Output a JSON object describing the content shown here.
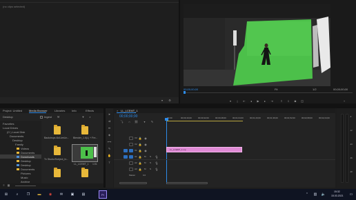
{
  "source_monitor": {
    "label": "(no clips selected)"
  },
  "program_monitor": {
    "timecode_left": "00;00;00;00",
    "fit": "Fit",
    "quality": "1/2",
    "timecode_right": "00;00;00;00"
  },
  "project_panel": {
    "tabs": [
      "Project: Untitled",
      "Media Browser",
      "Libraries",
      "Info",
      "Effects"
    ],
    "active_tab": 1,
    "path_label": "Desktop",
    "ingest_label": "Ingest",
    "tree": [
      "Favorites",
      "Local Drives",
      "(C:) Local Disk",
      "Documents",
      "Desktop",
      "Family",
      "Videos",
      "Documents",
      "Downloads",
      "Desktop",
      "Desktop",
      "Documents",
      "Pictures",
      "Music",
      "Archive",
      "Network"
    ],
    "files": [
      {
        "name": "Backdrops 4k/LiveLin...",
        "type": "folder"
      },
      {
        "name": "Blender_1.6(L) + Fre...",
        "type": "folder"
      },
      {
        "name": "Tv Studio/Subject_In...",
        "type": "folder"
      },
      {
        "name": "LL_LCEMT_1",
        "duration": "1:01",
        "type": "video"
      },
      {
        "name": "",
        "type": "folder"
      },
      {
        "name": "",
        "type": "folder"
      }
    ]
  },
  "timeline": {
    "sequence_tab": "LL_LCEMT_1",
    "timecode": "00;00;00;00",
    "ruler": [
      "00;00",
      "00;00;16;00",
      "00;00;32;00",
      "00;00;48;00",
      "00;01;04;00",
      "00;01;20;00",
      "00;01;36;00",
      "00;01;52;00",
      "00;02;08;00",
      "00;02;24;00"
    ],
    "video_tracks": [
      "V3",
      "V2",
      "V1"
    ],
    "audio_tracks": [
      "A1",
      "A2",
      "A3"
    ],
    "master_label": "Master",
    "master_value": "0.0",
    "clip_label": "LL_LCEMT_1.mp",
    "clip_color": "#e08bd6"
  },
  "taskbar": {
    "apps": [
      "start-icon",
      "search-icon",
      "task-view-icon",
      "folder-icon",
      "chrome-icon",
      "mail-icon",
      "store-icon",
      "photos-icon",
      "premiere-icon"
    ],
    "time": "15:32",
    "date": "15.03.2021"
  },
  "colors": {
    "accent": "#2d8ceb",
    "greenscreen": "#4cc04a",
    "clip": "#e08bd6",
    "folder": "#e8b83a"
  }
}
